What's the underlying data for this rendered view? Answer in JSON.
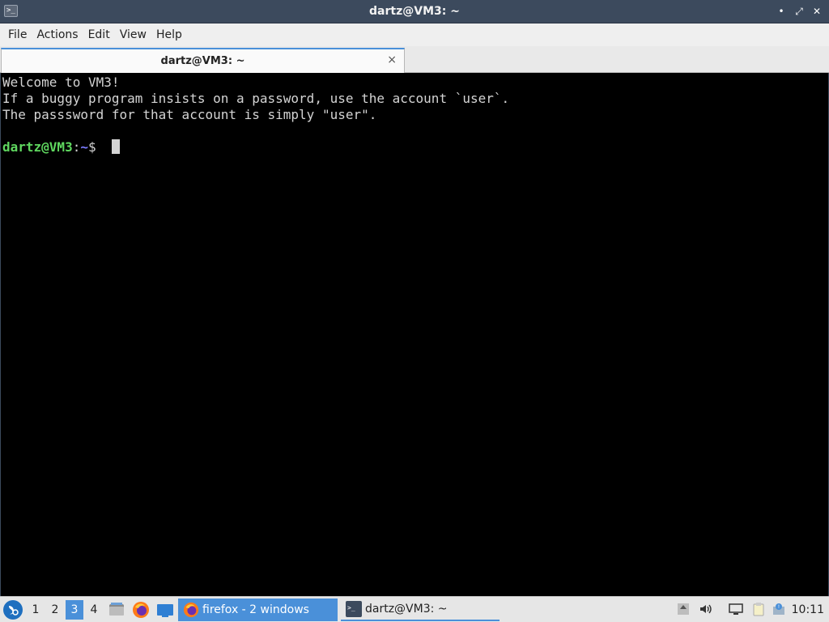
{
  "window": {
    "title": "dartz@VM3: ~",
    "app_icon_glyph": ">_",
    "minimize_glyph": "•",
    "maximize_glyph": "⤢",
    "close_glyph": "✕"
  },
  "menubar": {
    "items": [
      "File",
      "Actions",
      "Edit",
      "View",
      "Help"
    ]
  },
  "tab": {
    "label": "dartz@VM3: ~",
    "close_glyph": "×"
  },
  "terminal": {
    "lines": [
      "Welcome to VM3!",
      "If a buggy program insists on a password, use the account `user`.",
      "The passsword for that account is simply \"user\".",
      ""
    ],
    "prompt": {
      "user_host": "dartz@VM3",
      "separator": ":",
      "path": "~",
      "symbol": "$ "
    }
  },
  "taskbar": {
    "workspaces": [
      "1",
      "2",
      "3",
      "4"
    ],
    "active_workspace": "3",
    "tasks": [
      {
        "label": "firefox - 2 windows",
        "icon": "firefox-icon",
        "active": true
      },
      {
        "label": "dartz@VM3: ~",
        "icon": "terminal-icon",
        "active": false
      }
    ],
    "clock": "10:11"
  },
  "colors": {
    "titlebar": "#3c4a5d",
    "prompt_user": "#5fd75f",
    "prompt_path": "#7b7bff",
    "accent": "#4a90d9"
  }
}
